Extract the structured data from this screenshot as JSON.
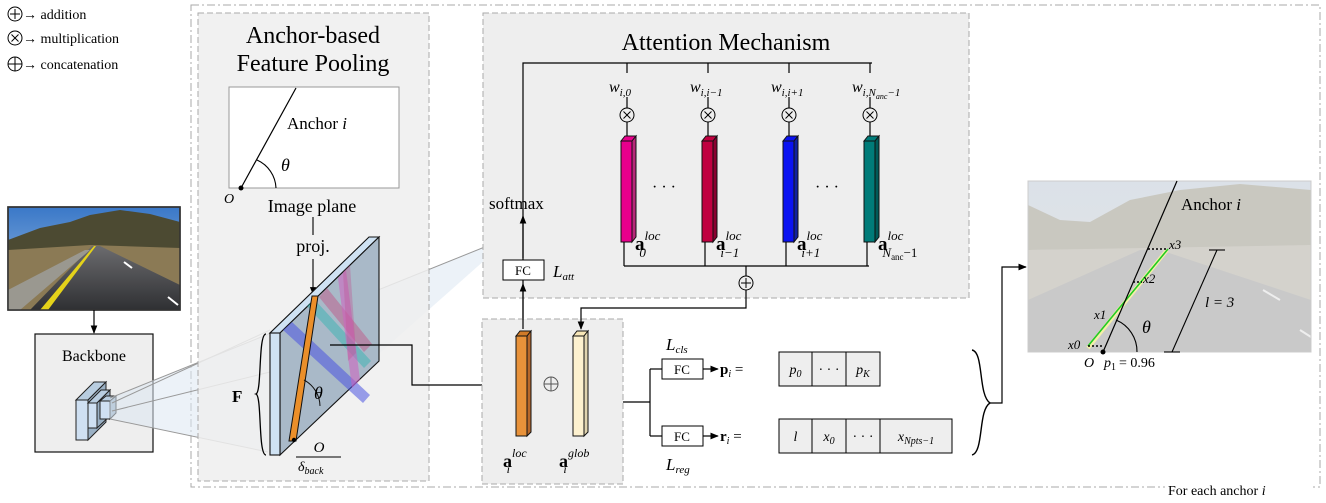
{
  "legend": [
    {
      "symbol": "addition",
      "label": "→ addition"
    },
    {
      "symbol": "multiplication",
      "label": "→ multiplication"
    },
    {
      "symbol": "concatenation",
      "label": "→ concatenation"
    }
  ],
  "input": {
    "image": "road-scene",
    "backbone_label": "Backbone"
  },
  "pooling": {
    "title_line1": "Anchor-based",
    "title_line2": "Feature Pooling",
    "anchor_label": "Anchor",
    "anchor_index": "i",
    "theta": "θ",
    "origin": "O",
    "image_plane_label": "Image plane",
    "proj_label": "proj.",
    "feature_map_label": "F",
    "origin_scaled_num": "O",
    "origin_scaled_den": "δ",
    "origin_scaled_den_sub": "back"
  },
  "attention": {
    "title": "Attention Mechanism",
    "softmax_label": "softmax",
    "fc_label": "FC",
    "loss_label": "L",
    "loss_sub": "att",
    "weights": [
      {
        "base": "w",
        "sub": "i,0"
      },
      {
        "base": "w",
        "sub": "i,i−1"
      },
      {
        "base": "w",
        "sub": "i,i+1"
      },
      {
        "base": "w",
        "sub": "i,N",
        "subsub": "anc",
        "tail": "−1"
      }
    ],
    "features": [
      {
        "base": "a",
        "sup": "loc",
        "sub": "0",
        "color": "#e8008c",
        "side": "#b8287a"
      },
      {
        "base": "a",
        "sup": "loc",
        "sub": "i−1",
        "color": "#c00040",
        "side": "#8a0030"
      },
      {
        "base": "a",
        "sup": "loc",
        "sub": "i+1",
        "color": "#0a12f0",
        "side": "#1020a0"
      },
      {
        "base": "a",
        "sup": "loc",
        "sub": "N",
        "subsub": "anc",
        "tail": "−1",
        "color": "#007b78",
        "side": "#005a58"
      }
    ],
    "ellipsis": "· · ·"
  },
  "concat": {
    "local": {
      "base": "a",
      "sup": "loc",
      "sub": "i",
      "color": "#e8923a"
    },
    "global": {
      "base": "a",
      "sup": "glob",
      "sub": "i",
      "color": "#fdf1cf"
    }
  },
  "heads": {
    "cls": {
      "loss": "L",
      "loss_sub": "cls",
      "fc": "FC",
      "output": "p",
      "output_sub": "i",
      "cells": [
        "p0",
        "· · ·",
        "pK"
      ]
    },
    "reg": {
      "loss": "L",
      "loss_sub": "reg",
      "fc": "FC",
      "output": "r",
      "output_sub": "i",
      "cells": [
        "l",
        "x0",
        "· · ·",
        "xNpts−1"
      ]
    }
  },
  "result": {
    "anchor_label": "Anchor",
    "anchor_index": "i",
    "points": [
      "x0",
      "x1",
      "x2",
      "x3"
    ],
    "length_label": "l = 3",
    "theta": "θ",
    "origin": "O",
    "prob_label": "p",
    "prob_sub": "1",
    "prob_value": "= 0.96"
  },
  "footer": {
    "label": "For each anchor",
    "index": "i"
  }
}
